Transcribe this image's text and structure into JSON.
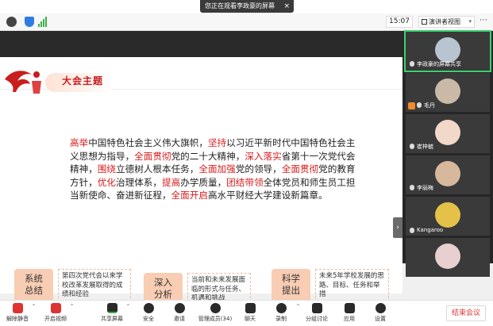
{
  "banner": {
    "text": "您正在观看李政豪的屏幕",
    "close_label": "×"
  },
  "toolbar": {
    "time": "15:07",
    "view_label": "演讲者视图",
    "more": "⋯"
  },
  "slide": {
    "title": "大会主题",
    "paragraph": [
      {
        "t": "高举",
        "hl": true
      },
      {
        "t": "中国特色社会主义伟大旗帜，",
        "hl": false
      },
      {
        "t": "坚持",
        "hl": true
      },
      {
        "t": "以习近平新时代中国特色社会主义思想为指导，",
        "hl": false
      },
      {
        "t": "全面贯彻",
        "hl": true
      },
      {
        "t": "党的二十大精神，",
        "hl": false
      },
      {
        "t": "深入落实",
        "hl": true
      },
      {
        "t": "省第十一次党代会精神，",
        "hl": false
      },
      {
        "t": "围绕",
        "hl": true
      },
      {
        "t": "立德树人根本任务，",
        "hl": false
      },
      {
        "t": "全面加强",
        "hl": true
      },
      {
        "t": "党的领导，",
        "hl": false
      },
      {
        "t": "全面贯彻",
        "hl": true
      },
      {
        "t": "党的教育方针，",
        "hl": false
      },
      {
        "t": "优化",
        "hl": true
      },
      {
        "t": "治理体系，",
        "hl": false
      },
      {
        "t": "提高",
        "hl": true
      },
      {
        "t": "办学质量，",
        "hl": false
      },
      {
        "t": "团结带领",
        "hl": true
      },
      {
        "t": "全体党员和师生员工担当新使命、奋进新征程，",
        "hl": false
      },
      {
        "t": "全面开启",
        "hl": true
      },
      {
        "t": "高水平财经大学建设新篇章。",
        "hl": false
      }
    ],
    "boxes": [
      {
        "tag_line1": "系统",
        "tag_line2": "总结",
        "desc": "第四次党代会以来学校改革发展取得的成绩和经验"
      },
      {
        "tag_line1": "深入",
        "tag_line2": "分析",
        "desc": "当前和未来发展面临的形式与任务、机遇和挑战"
      },
      {
        "tag_line1": "科学",
        "tag_line2": "提出",
        "desc": "未来5年学校发展的思路、目标、任务和举措"
      }
    ]
  },
  "participants": [
    {
      "name": "李政豪的屏幕共享",
      "active": true
    },
    {
      "name": "毛丹",
      "active": false
    },
    {
      "name": "崔梓毓",
      "active": false
    },
    {
      "name": "李丽梅",
      "active": false
    },
    {
      "name": "Kangaroo",
      "active": false
    },
    {
      "name": "",
      "active": false
    }
  ],
  "controls": [
    {
      "label": "解除静音"
    },
    {
      "label": "开启视频"
    },
    {
      "label": "共享屏幕"
    },
    {
      "label": "安全"
    },
    {
      "label": "邀请"
    },
    {
      "label": "管理成员(34)"
    },
    {
      "label": "聊天"
    },
    {
      "label": "录制"
    },
    {
      "label": "分组讨论"
    },
    {
      "label": "应用"
    },
    {
      "label": "设置"
    }
  ],
  "end_button": "结束会议",
  "colors": {
    "highlight": "#d81b1b",
    "accent_green": "#3cd070",
    "tag_bg": "#f8cdb3"
  }
}
